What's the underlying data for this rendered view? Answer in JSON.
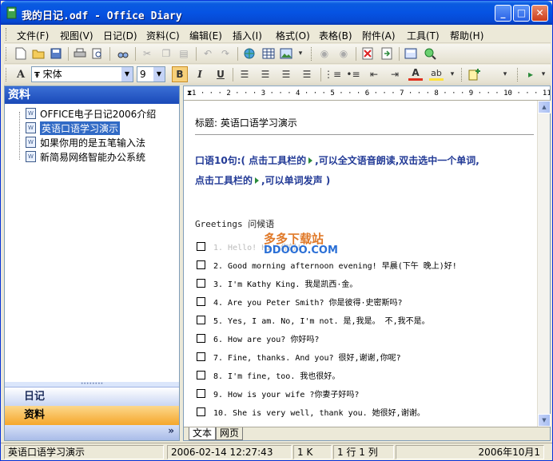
{
  "window": {
    "title": "我的日记.odf - Office Diary",
    "min_label": "_",
    "max_label": "□",
    "close_label": "✕"
  },
  "menu": [
    {
      "label": "文件(F)"
    },
    {
      "label": "视图(V)"
    },
    {
      "label": "日记(D)"
    },
    {
      "label": "资料(C)"
    },
    {
      "label": "编辑(E)"
    },
    {
      "label": "插入(I)"
    },
    {
      "label": "格式(O)"
    },
    {
      "label": "表格(B)"
    },
    {
      "label": "附件(A)"
    },
    {
      "label": "工具(T)"
    },
    {
      "label": "帮助(H)"
    }
  ],
  "toolbar_format": {
    "font_name": "宋体",
    "font_size": "9",
    "bold": "B",
    "italic": "I",
    "underline": "U",
    "font_color": "A",
    "highlight": "ab"
  },
  "sidebar": {
    "header": "资料",
    "items": [
      {
        "label": "OFFICE电子日记2006介绍",
        "selected": false
      },
      {
        "label": "英语口语学习演示",
        "selected": true
      },
      {
        "label": "如果你用的是五笔输入法",
        "selected": false
      },
      {
        "label": "新简易网络智能办公系统",
        "selected": false
      }
    ],
    "nav_diary": "日记",
    "nav_data": "资料",
    "nav_more": "»"
  },
  "ruler": {
    "text": "1 · · · 2 · · · 3 · · · 4 · · · 5 · · · 6 · · · 7 · · · 8 · · · 9 · · · 10 · · · 11 · · 12"
  },
  "document": {
    "title_label": "标题:",
    "title_value": "英语口语学习演示",
    "intro_line1_a": "口语10句:( 点击工具栏的",
    "intro_line1_b": ",可以全文语音朗读,双击选中一个单词,",
    "intro_line2_a": "点击工具栏的",
    "intro_line2_b": ",可以单词发声 )",
    "greeting": "Greetings 问候语",
    "sentences": [
      "1. Hello! Hi! 你好!",
      "2. Good morning  afternoon  evening! 早晨(下午 晚上)好!",
      "3. I'm Kathy King. 我是凯西·金。",
      "4. Are you Peter Smith? 你是彼得·史密斯吗?",
      "5. Yes, I am.  No, I'm not. 是,我是。 不,我不是。",
      "6. How are you? 你好吗?",
      "7. Fine, thanks. And you? 很好,谢谢,你呢?",
      "8. I'm fine, too. 我也很好。",
      "9. How is  your wife ?你妻子好吗?",
      "10. She is very well, thank you. 她很好,谢谢。"
    ],
    "watermark_top": "多多下载站",
    "watermark_bottom": "DDOOO.COM"
  },
  "tabs": {
    "text_tab": "文本",
    "web_tab": "网页"
  },
  "status": {
    "doc_name": "英语口语学习演示",
    "timestamp": "2006-02-14 12:27:43",
    "size": "1 K",
    "position": "1 行  1 列",
    "date": "2006年10月1"
  }
}
